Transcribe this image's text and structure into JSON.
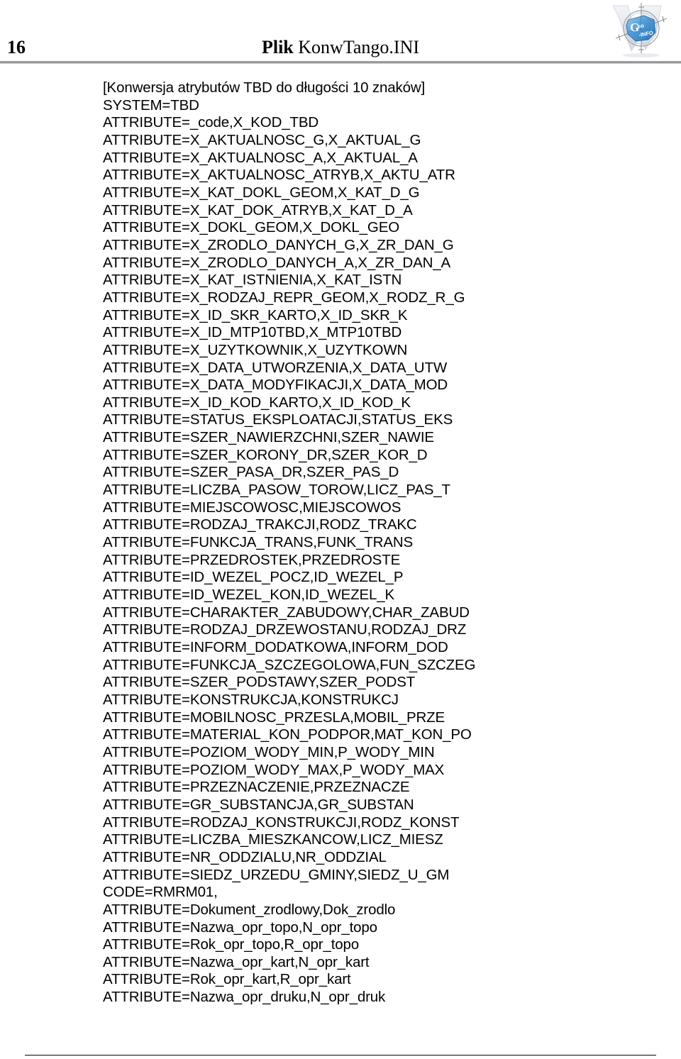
{
  "header": {
    "page_number": "16",
    "title_bold": "Plik",
    "title_rest": "KonwTango.INI",
    "logo_alt": "geo-info-logo",
    "logo_text_geo": "Geo",
    "logo_text_info": "INFO"
  },
  "document": {
    "lines": [
      "[Konwersja atrybutów TBD do długości 10 znaków]",
      "SYSTEM=TBD",
      "ATTRIBUTE=_code,X_KOD_TBD",
      "ATTRIBUTE=X_AKTUALNOSC_G,X_AKTUAL_G",
      "ATTRIBUTE=X_AKTUALNOSC_A,X_AKTUAL_A",
      "ATTRIBUTE=X_AKTUALNOSC_ATRYB,X_AKTU_ATR",
      "ATTRIBUTE=X_KAT_DOKL_GEOM,X_KAT_D_G",
      "ATTRIBUTE=X_KAT_DOK_ATRYB,X_KAT_D_A",
      "ATTRIBUTE=X_DOKL_GEOM,X_DOKL_GEO",
      "ATTRIBUTE=X_ZRODLO_DANYCH_G,X_ZR_DAN_G",
      "ATTRIBUTE=X_ZRODLO_DANYCH_A,X_ZR_DAN_A",
      "ATTRIBUTE=X_KAT_ISTNIENIA,X_KAT_ISTN",
      "ATTRIBUTE=X_RODZAJ_REPR_GEOM,X_RODZ_R_G",
      "ATTRIBUTE=X_ID_SKR_KARTO,X_ID_SKR_K",
      "ATTRIBUTE=X_ID_MTP10TBD,X_MTP10TBD",
      "ATTRIBUTE=X_UZYTKOWNIK,X_UZYTKOWN",
      "ATTRIBUTE=X_DATA_UTWORZENIA,X_DATA_UTW",
      "ATTRIBUTE=X_DATA_MODYFIKACJI,X_DATA_MOD",
      "ATTRIBUTE=X_ID_KOD_KARTO,X_ID_KOD_K",
      "ATTRIBUTE=STATUS_EKSPLOATACJI,STATUS_EKS",
      "ATTRIBUTE=SZER_NAWIERZCHNI,SZER_NAWIE",
      "ATTRIBUTE=SZER_KORONY_DR,SZER_KOR_D",
      "ATTRIBUTE=SZER_PASA_DR,SZER_PAS_D",
      "ATTRIBUTE=LICZBA_PASOW_TOROW,LICZ_PAS_T",
      "ATTRIBUTE=MIEJSCOWOSC,MIEJSCOWOS",
      "ATTRIBUTE=RODZAJ_TRAKCJI,RODZ_TRAKC",
      "ATTRIBUTE=FUNKCJA_TRANS,FUNK_TRANS",
      "ATTRIBUTE=PRZEDROSTEK,PRZEDROSTE",
      "ATTRIBUTE=ID_WEZEL_POCZ,ID_WEZEL_P",
      "ATTRIBUTE=ID_WEZEL_KON,ID_WEZEL_K",
      "ATTRIBUTE=CHARAKTER_ZABUDOWY,CHAR_ZABUD",
      "ATTRIBUTE=RODZAJ_DRZEWOSTANU,RODZAJ_DRZ",
      "ATTRIBUTE=INFORM_DODATKOWA,INFORM_DOD",
      "ATTRIBUTE=FUNKCJA_SZCZEGOLOWA,FUN_SZCZEG",
      "ATTRIBUTE=SZER_PODSTAWY,SZER_PODST",
      "ATTRIBUTE=KONSTRUKCJA,KONSTRUKCJ",
      "ATTRIBUTE=MOBILNOSC_PRZESLA,MOBIL_PRZE",
      "ATTRIBUTE=MATERIAL_KON_PODPOR,MAT_KON_PO",
      "ATTRIBUTE=POZIOM_WODY_MIN,P_WODY_MIN",
      "ATTRIBUTE=POZIOM_WODY_MAX,P_WODY_MAX",
      "ATTRIBUTE=PRZEZNACZENIE,PRZEZNACZE",
      "ATTRIBUTE=GR_SUBSTANCJA,GR_SUBSTAN",
      "ATTRIBUTE=RODZAJ_KONSTRUKCJI,RODZ_KONST",
      "ATTRIBUTE=LICZBA_MIESZKANCOW,LICZ_MIESZ",
      "ATTRIBUTE=NR_ODDZIALU,NR_ODDZIAL",
      "ATTRIBUTE=SIEDZ_URZEDU_GMINY,SIEDZ_U_GM",
      "CODE=RMRM01,",
      "ATTRIBUTE=Dokument_zrodlowy,Dok_zrodlo",
      "ATTRIBUTE=Nazwa_opr_topo,N_opr_topo",
      "ATTRIBUTE=Rok_opr_topo,R_opr_topo",
      "ATTRIBUTE=Nazwa_opr_kart,N_opr_kart",
      "ATTRIBUTE=Rok_opr_kart,R_opr_kart",
      "ATTRIBUTE=Nazwa_opr_druku,N_opr_druk"
    ]
  },
  "colors": {
    "text": "#000000",
    "header_rule": "#8f8f8f",
    "footer_rule": "#2b2b2b",
    "logo_blue": "#3f8fd0"
  }
}
